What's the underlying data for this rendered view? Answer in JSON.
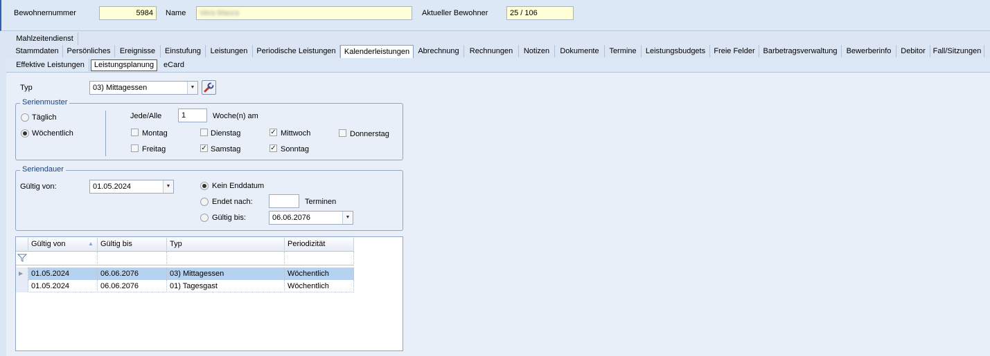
{
  "header": {
    "bewohnernummer_label": "Bewohnernummer",
    "bewohnernummer_value": "5984",
    "name_label": "Name",
    "name_value": "Vera Maura",
    "aktueller_label": "Aktueller Bewohner",
    "aktueller_value": "25 / 106"
  },
  "tabs_row1": [
    "Mahlzeitendienst"
  ],
  "tabs_row2": [
    "Stammdaten",
    "Persönliches",
    "Ereignisse",
    "Einstufung",
    "Leistungen",
    "Periodische Leistungen",
    "Kalenderleistungen",
    "Abrechnung",
    "Rechnungen",
    "Notizen",
    "Dokumente",
    "Termine",
    "Leistungsbudgets",
    "Freie Felder",
    "Barbetragsverwaltung",
    "Bewerberinfo",
    "Debitor",
    "Fall/Sitzungen"
  ],
  "active_tab": "Kalenderleistungen",
  "subtabs": [
    "Effektive Leistungen",
    "Leistungsplanung",
    "eCard"
  ],
  "active_subtab": "Leistungsplanung",
  "typ": {
    "label": "Typ",
    "value": "03) Mittagessen",
    "tool_icon": "wrench-icon"
  },
  "serienmuster": {
    "legend": "Serienmuster",
    "taeglich": "Täglich",
    "woechentlich": "Wöchentlich",
    "jede_alle_label": "Jede/Alle",
    "jede_alle_value": "1",
    "wochen_am": "Woche(n) am",
    "days": [
      {
        "label": "Montag",
        "checked": false
      },
      {
        "label": "Dienstag",
        "checked": false
      },
      {
        "label": "Mittwoch",
        "checked": true
      },
      {
        "label": "Donnerstag",
        "checked": false
      },
      {
        "label": "Freitag",
        "checked": false
      },
      {
        "label": "Samstag",
        "checked": true
      },
      {
        "label": "Sonntag",
        "checked": true
      }
    ]
  },
  "seriendauer": {
    "legend": "Seriendauer",
    "gueltig_von_label": "Gültig von:",
    "gueltig_von_value": "01.05.2024",
    "kein_enddatum": "Kein Enddatum",
    "endet_nach": "Endet nach:",
    "terminen": "Terminen",
    "gueltig_bis_label": "Gültig bis:",
    "gueltig_bis_value": "06.06.2076"
  },
  "grid": {
    "columns": [
      "Gültig von",
      "Gültig bis",
      "Typ",
      "Periodizität"
    ],
    "rows": [
      [
        "01.05.2024",
        "06.06.2076",
        "03) Mittagessen",
        "Wöchentlich"
      ],
      [
        "01.05.2024",
        "06.06.2076",
        "01) Tagesgast",
        "Wöchentlich"
      ]
    ]
  }
}
